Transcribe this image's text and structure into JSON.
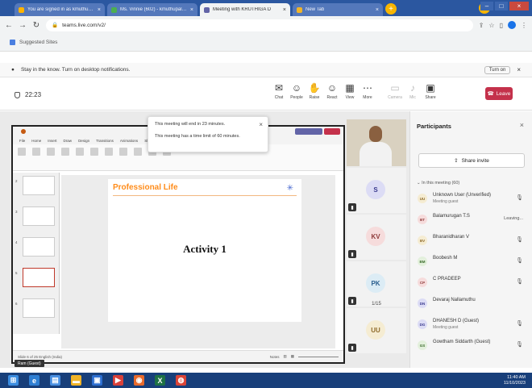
{
  "browser": {
    "tabs": [
      {
        "label": "You are signed in as kmuthupalani",
        "active": false
      },
      {
        "label": "Ms. Vinnie (602) - kmuthupalani@ko...",
        "active": false
      },
      {
        "label": "Meeting with KRUTHIGA D",
        "active": true
      },
      {
        "label": "New Tab",
        "active": false
      }
    ],
    "new_tab": "+",
    "address": "teams.live.com/v2/",
    "bookmarks_label": "Suggested Sites"
  },
  "notification": {
    "text": "Stay in the know. Turn on desktop notifications.",
    "turn_on": "Turn on"
  },
  "meeting": {
    "timer": "22:23",
    "tools": [
      {
        "label": "Chat",
        "icon": "chat-icon",
        "glyph": "✉",
        "dim": false
      },
      {
        "label": "People",
        "icon": "people-icon",
        "glyph": "☺",
        "dim": false
      },
      {
        "label": "Raise",
        "icon": "hand-icon",
        "glyph": "✋",
        "dim": false
      },
      {
        "label": "React",
        "icon": "react-icon",
        "glyph": "☺",
        "dim": false
      },
      {
        "label": "View",
        "icon": "view-icon",
        "glyph": "▦",
        "dim": false
      },
      {
        "label": "More",
        "icon": "more-icon",
        "glyph": "⋯",
        "dim": false
      },
      {
        "label": "Camera",
        "icon": "camera-icon",
        "glyph": "▭",
        "dim": true
      },
      {
        "label": "Mic",
        "icon": "mic-icon",
        "glyph": "♪",
        "dim": true
      },
      {
        "label": "Share",
        "icon": "share-icon",
        "glyph": "▣",
        "dim": false
      }
    ],
    "leave": "Leave"
  },
  "popup": {
    "line1": "This meeting will end in 23 minutes.",
    "line2": "This meeting has a time limit of 60 minutes."
  },
  "slide": {
    "title": "Professional Life",
    "body": "Activity 1"
  },
  "ppt": {
    "menu": [
      "File",
      "Home",
      "Insert",
      "Draw",
      "Design",
      "Transitions",
      "Animations",
      "Slide Show"
    ],
    "status_left": "Slide 6 of 25  English (India)",
    "status_right": "Notes"
  },
  "videos": {
    "avatars": [
      {
        "initials": "S",
        "bg": "#dcdcf5",
        "fg": "#3b3b8f"
      },
      {
        "initials": "KV",
        "bg": "#f6dcdc",
        "fg": "#8f3b3b"
      },
      {
        "initials": "PK",
        "bg": "#dcecf5",
        "fg": "#2b5f8f"
      },
      {
        "initials": "UU",
        "bg": "#f5ecd2",
        "fg": "#8f6b2b"
      }
    ],
    "pager": "1/15"
  },
  "participants": {
    "title": "Participants",
    "share_invite": "Share invite",
    "section": "In this meeting (60)",
    "list": [
      {
        "initials": "UU",
        "name": "Unknown User (Unverified)",
        "sub": "Meeting guest",
        "status": "mic-off",
        "status_text": "",
        "bg": "#f5ecd2",
        "fg": "#8f6b2b"
      },
      {
        "initials": "BT",
        "name": "Balamurugan T.S",
        "sub": "",
        "status": "text",
        "status_text": "Leaving...",
        "bg": "#f6dcdc",
        "fg": "#8f3b3b"
      },
      {
        "initials": "BV",
        "name": "Bharanidharan V",
        "sub": "",
        "status": "mic-off",
        "status_text": "",
        "bg": "#f5ecd2",
        "fg": "#8f6b2b"
      },
      {
        "initials": "BM",
        "name": "Boobesh M",
        "sub": "",
        "status": "mic-off",
        "status_text": "",
        "bg": "#e3f0dc",
        "fg": "#3b6b2b"
      },
      {
        "initials": "CP",
        "name": "C PRADEEP",
        "sub": "",
        "status": "mic-off",
        "status_text": "",
        "bg": "#f6dcdc",
        "fg": "#8f3b3b"
      },
      {
        "initials": "DN",
        "name": "Devaraj Nallamuthu",
        "sub": "",
        "status": "none",
        "status_text": "",
        "bg": "#dcdcf5",
        "fg": "#3b3b8f"
      },
      {
        "initials": "DG",
        "name": "DHANESH D (Guest)",
        "sub": "Meeting guest",
        "status": "mic-off",
        "status_text": "",
        "bg": "#dcdcf5",
        "fg": "#3b3b8f"
      },
      {
        "initials": "GS",
        "name": "Gowtham Siddarth (Guest)",
        "sub": "",
        "status": "mic-off",
        "status_text": "",
        "bg": "#e3f0dc",
        "fg": "#3b6b2b"
      }
    ]
  },
  "name_chip": "Ram (Guest)",
  "taskbar": {
    "apps": [
      {
        "icon": "start-icon",
        "color": "#3b8de0",
        "glyph": "⊞"
      },
      {
        "icon": "edge-icon",
        "color": "#2f7fd3",
        "glyph": "e"
      },
      {
        "icon": "files-icon",
        "color": "#4a90e2",
        "glyph": "▤"
      },
      {
        "icon": "folder-icon",
        "color": "#f0b429",
        "glyph": "▬"
      },
      {
        "icon": "store-icon",
        "color": "#2d6fd1",
        "glyph": "▣"
      },
      {
        "icon": "media-icon",
        "color": "#d9413a",
        "glyph": "▶"
      },
      {
        "icon": "firefox-icon",
        "color": "#e86a2c",
        "glyph": "◉"
      },
      {
        "icon": "excel-icon",
        "color": "#1e7145",
        "glyph": "X"
      },
      {
        "icon": "chrome-icon",
        "color": "#db4437",
        "glyph": "◍"
      }
    ],
    "time": "11:40 AM",
    "date": "11/10/2023"
  }
}
